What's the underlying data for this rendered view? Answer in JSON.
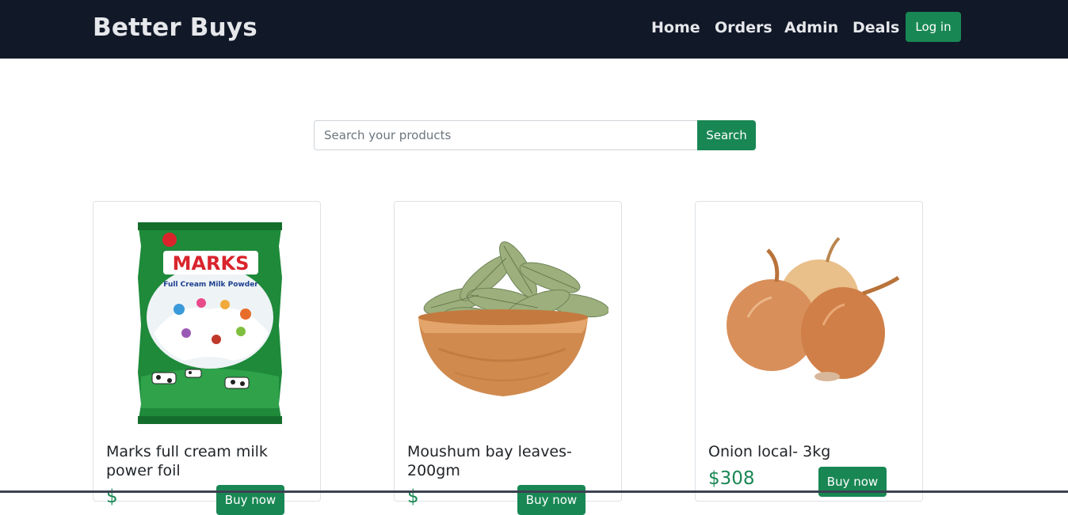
{
  "navbar": {
    "brand": "Better Buys",
    "links": [
      "Home",
      "Orders",
      "Admin",
      "Deals"
    ],
    "login_label": "Log in"
  },
  "search": {
    "placeholder": "Search your products",
    "button_label": "Search"
  },
  "products": [
    {
      "title": "Marks full cream milk power foil",
      "price": "$",
      "buy_label": "Buy now",
      "image": "milk-powder-pack"
    },
    {
      "title": "Moushum bay leaves- 200gm",
      "price": "$",
      "buy_label": "Buy now",
      "image": "bay-leaves-bowl"
    },
    {
      "title": "Onion local- 3kg",
      "price": "$308",
      "buy_label": "Buy now",
      "image": "onions"
    }
  ],
  "colors": {
    "navbar_bg": "#111827",
    "accent_green": "#198754"
  }
}
